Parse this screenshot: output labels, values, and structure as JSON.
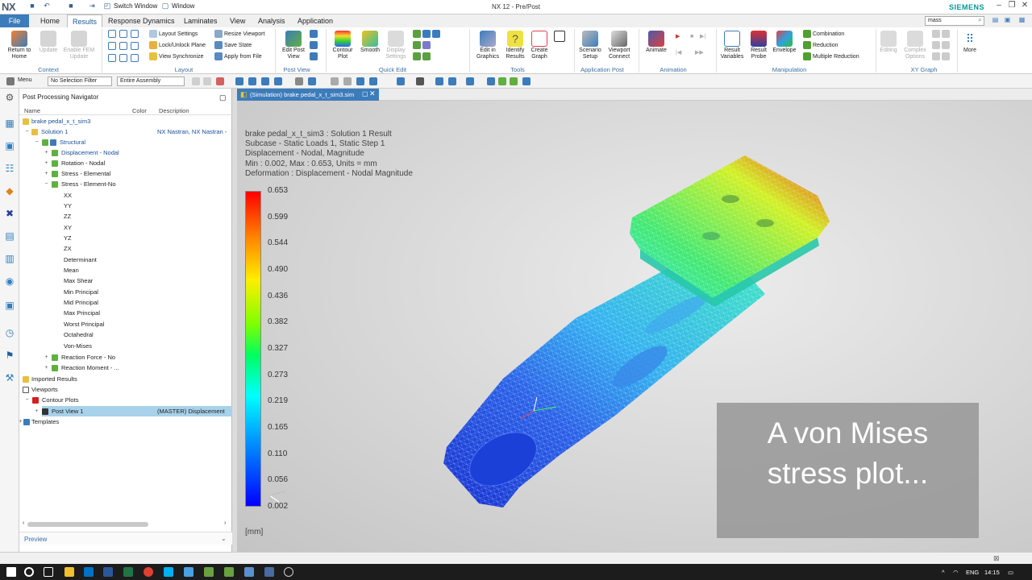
{
  "window": {
    "logo": "NX",
    "title": "NX 12 - Pre/Post",
    "brand": "SIEMENS",
    "switch_window": "Switch Window",
    "window_menu": "Window"
  },
  "tabs": [
    "Home",
    "Results",
    "Response Dynamics",
    "Laminates",
    "View",
    "Analysis",
    "Application"
  ],
  "file_tab": "File",
  "search": {
    "value": "mass"
  },
  "ribbon": {
    "context": {
      "return_home": "Return to Home",
      "update": "Update",
      "enable_fem": "Enable FEM Update",
      "group": "Context"
    },
    "layout": {
      "layout_settings": "Layout Settings",
      "lock_unlock": "Lock/Unlock Plane",
      "view_sync": "View Synchronize",
      "resize_viewport": "Resize Viewport",
      "save_state": "Save State",
      "apply_from_file": "Apply from File",
      "group": "Layout"
    },
    "post_view": {
      "edit_post_view": "Edit Post View",
      "group": "Post View"
    },
    "quick_edit": {
      "contour_plot": "Contour Plot",
      "smooth": "Smooth",
      "display_settings": "Display Settings",
      "group": "Quick Edit"
    },
    "tools": {
      "edit_in_graphics": "Edit in Graphics",
      "identify_results": "Identify Results",
      "create_graph": "Create Graph",
      "group": "Tools"
    },
    "app_post": {
      "scenario_setup": "Scenario Setup",
      "viewport_connect": "Viewport Connect",
      "group": "Application Post"
    },
    "animation": {
      "animate": "Animate",
      "group": "Animation"
    },
    "manipulation": {
      "result_variables": "Result Variables",
      "result_probe": "Result Probe",
      "envelope": "Envelope",
      "combination": "Combination",
      "reduction": "Reduction",
      "multiple_reduction": "Multiple Reduction",
      "group": "Manipulation"
    },
    "xy": {
      "editing": "Editing",
      "complex_options": "Complex Options",
      "group": "XY Graph"
    },
    "more": "More"
  },
  "selection": {
    "menu": "Menu",
    "filter": "No Selection Filter",
    "scope": "Entire Assembly"
  },
  "navigator": {
    "title": "Post Processing Navigator",
    "columns": [
      "Name",
      "Color",
      "Description"
    ],
    "rows": [
      {
        "label": "brake pedal_x_t_sim3",
        "desc": ""
      },
      {
        "label": "Solution 1",
        "desc": "NX Nastran, NX Nastran -"
      },
      {
        "label": "Structural",
        "desc": ""
      },
      {
        "label": "Displacement - Nodal",
        "desc": ""
      },
      {
        "label": "Rotation - Nodal",
        "desc": ""
      },
      {
        "label": "Stress - Elemental",
        "desc": ""
      },
      {
        "label": "Stress - Element-No",
        "desc": ""
      },
      {
        "label": "XX",
        "desc": ""
      },
      {
        "label": "YY",
        "desc": ""
      },
      {
        "label": "ZZ",
        "desc": ""
      },
      {
        "label": "XY",
        "desc": ""
      },
      {
        "label": "YZ",
        "desc": ""
      },
      {
        "label": "ZX",
        "desc": ""
      },
      {
        "label": "Determinant",
        "desc": ""
      },
      {
        "label": "Mean",
        "desc": ""
      },
      {
        "label": "Max Shear",
        "desc": ""
      },
      {
        "label": "Min Principal",
        "desc": ""
      },
      {
        "label": "Mid Principal",
        "desc": ""
      },
      {
        "label": "Max Principal",
        "desc": ""
      },
      {
        "label": "Worst Principal",
        "desc": ""
      },
      {
        "label": "Octahedral",
        "desc": ""
      },
      {
        "label": "Von-Mises",
        "desc": ""
      },
      {
        "label": "Reaction Force - No",
        "desc": ""
      },
      {
        "label": "Reaction Moment - ...",
        "desc": ""
      },
      {
        "label": "Imported Results",
        "desc": ""
      },
      {
        "label": "Viewports",
        "desc": ""
      },
      {
        "label": "Contour Plots",
        "desc": ""
      },
      {
        "label": "Post View 1",
        "desc": "(MASTER) Displacement"
      },
      {
        "label": "Templates",
        "desc": ""
      }
    ],
    "preview": "Preview"
  },
  "viewport": {
    "tab": "(Simulation) brake pedal_x_t_sim3.sim",
    "info": [
      "brake pedal_x_t_sim3 : Solution 1 Result",
      "Subcase - Static Loads 1, Static Step 1",
      "Displacement - Nodal, Magnitude",
      "Min : 0.002, Max : 0.653, Units = mm",
      "Deformation : Displacement - Nodal Magnitude"
    ],
    "legend": [
      "0.653",
      "0.599",
      "0.544",
      "0.490",
      "0.436",
      "0.382",
      "0.327",
      "0.273",
      "0.219",
      "0.165",
      "0.110",
      "0.056",
      "0.002"
    ],
    "units": "[mm]",
    "overlay": [
      "A von Mises",
      "stress plot..."
    ]
  },
  "taskbar": {
    "lang": "ENG",
    "time": "14:15"
  },
  "colors": {
    "accent": "#3c7cbb",
    "brand": "#009999",
    "selection": "#a8d1ea"
  }
}
